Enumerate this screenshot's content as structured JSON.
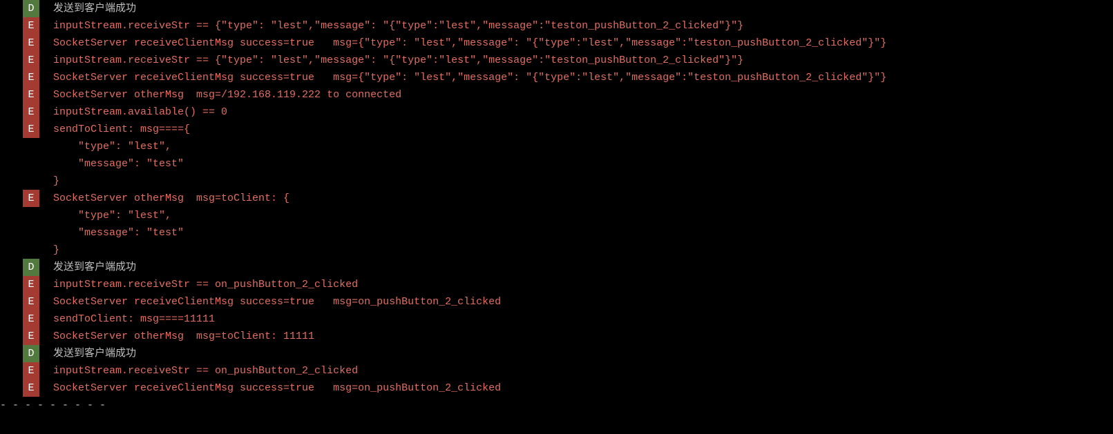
{
  "colors": {
    "bg": "#000000",
    "debug_badge": "#527a3e",
    "error_badge": "#a33b33",
    "debug_text": "#bfbfbf",
    "error_text": "#e36d61"
  },
  "log_entries": [
    {
      "level": "D",
      "lines": [
        "发送到客户端成功"
      ]
    },
    {
      "level": "E",
      "lines": [
        "inputStream.receiveStr == {\"type\": \"lest\",\"message\": \"{\"type\":\"lest\",\"message\":\"teston_pushButton_2_clicked\"}\"}"
      ]
    },
    {
      "level": "E",
      "lines": [
        "SocketServer receiveClientMsg success=true   msg={\"type\": \"lest\",\"message\": \"{\"type\":\"lest\",\"message\":\"teston_pushButton_2_clicked\"}\"}"
      ]
    },
    {
      "level": "E",
      "lines": [
        "inputStream.receiveStr == {\"type\": \"lest\",\"message\": \"{\"type\":\"lest\",\"message\":\"teston_pushButton_2_clicked\"}\"}"
      ]
    },
    {
      "level": "E",
      "lines": [
        "SocketServer receiveClientMsg success=true   msg={\"type\": \"lest\",\"message\": \"{\"type\":\"lest\",\"message\":\"teston_pushButton_2_clicked\"}\"}"
      ]
    },
    {
      "level": "E",
      "lines": [
        "SocketServer otherMsg  msg=/192.168.119.222 to connected"
      ]
    },
    {
      "level": "E",
      "lines": [
        "inputStream.available() == 0"
      ]
    },
    {
      "level": "E",
      "lines": [
        "sendToClient: msg===={",
        "    \"type\": \"lest\",",
        "    \"message\": \"test\"",
        "}"
      ]
    },
    {
      "level": "E",
      "lines": [
        "SocketServer otherMsg  msg=toClient: {",
        "    \"type\": \"lest\",",
        "    \"message\": \"test\"",
        "}"
      ]
    },
    {
      "level": "D",
      "lines": [
        "发送到客户端成功"
      ]
    },
    {
      "level": "E",
      "lines": [
        "inputStream.receiveStr == on_pushButton_2_clicked"
      ]
    },
    {
      "level": "E",
      "lines": [
        "SocketServer receiveClientMsg success=true   msg=on_pushButton_2_clicked"
      ]
    },
    {
      "level": "E",
      "lines": [
        "sendToClient: msg====11111"
      ]
    },
    {
      "level": "E",
      "lines": [
        "SocketServer otherMsg  msg=toClient: 11111"
      ]
    },
    {
      "level": "D",
      "lines": [
        "发送到客户端成功"
      ]
    },
    {
      "level": "E",
      "lines": [
        "inputStream.receiveStr == on_pushButton_2_clicked"
      ]
    },
    {
      "level": "E",
      "lines": [
        "SocketServer receiveClientMsg success=true   msg=on_pushButton_2_clicked"
      ]
    }
  ],
  "footer_dashes": "- - - - - - - - -"
}
